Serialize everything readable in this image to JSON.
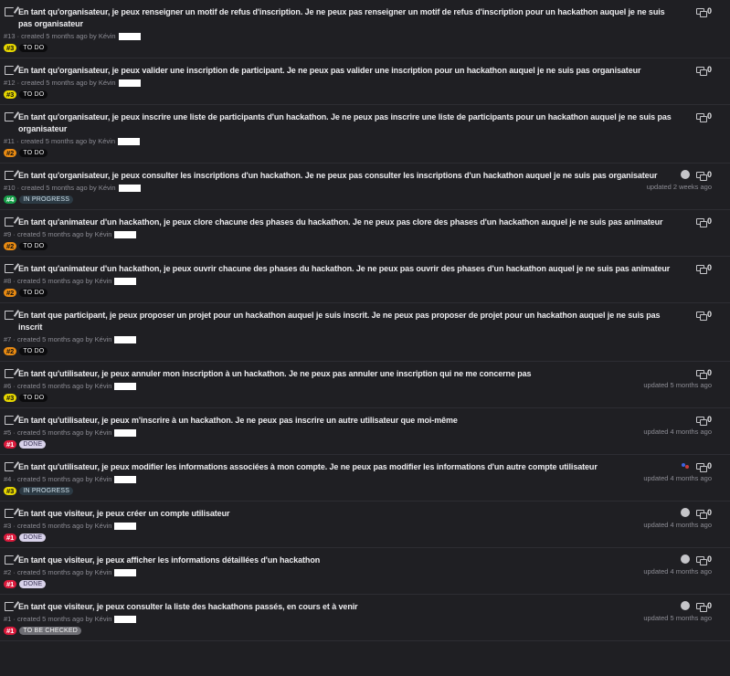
{
  "issues": [
    {
      "title": "En tant qu'organisateur, je peux renseigner un motif de refus d'inscription. Je ne peux pas renseigner un motif de refus d'inscription pour un hackathon auquel je ne suis pas organisateur",
      "meta": "#13 · created 5 months ago by Kévin",
      "badge": "#3",
      "badge_color": "#e6d600",
      "status": "TO DO",
      "status_class": "todo",
      "comments": "0",
      "updated": "",
      "avatar": ""
    },
    {
      "title": "En tant qu'organisateur, je peux valider une inscription de participant. Je ne peux pas valider une inscription pour un hackathon auquel je ne suis pas organisateur",
      "meta": "#12 · created 5 months ago by Kévin",
      "badge": "#3",
      "badge_color": "#e6d600",
      "status": "TO DO",
      "status_class": "todo",
      "comments": "0",
      "updated": "",
      "avatar": ""
    },
    {
      "title": "En tant qu'organisateur, je peux inscrire une liste de participants d'un hackathon. Je ne peux pas inscrire une liste de participants pour un hackathon auquel je ne suis pas organisateur",
      "meta": "#11 · created 5 months ago by Kévin",
      "badge": "#2",
      "badge_color": "#e88a12",
      "status": "TO DO",
      "status_class": "todo",
      "comments": "0",
      "updated": "",
      "avatar": ""
    },
    {
      "title": "En tant qu'organisateur, je peux consulter les inscriptions d'un hackathon. Je ne peux pas consulter les inscriptions d'un hackathon auquel je ne suis pas organisateur",
      "meta": "#10 · created 5 months ago by Kévin",
      "badge": "#4",
      "badge_color": "#18a04a",
      "status": "IN PROGRESS",
      "status_class": "progress",
      "comments": "0",
      "updated": "updated 2 weeks ago",
      "avatar": "grey"
    },
    {
      "title": "En tant qu'animateur d'un hackathon, je peux clore chacune des phases du hackathon. Je ne peux pas clore des phases d'un hackathon auquel je ne suis pas animateur",
      "meta": "#9 · created 5 months ago by Kévin",
      "badge": "#2",
      "badge_color": "#e88a12",
      "status": "TO DO",
      "status_class": "todo",
      "comments": "0",
      "updated": "",
      "avatar": ""
    },
    {
      "title": "En tant qu'animateur d'un hackathon, je peux ouvrir chacune des phases du hackathon. Je ne peux pas ouvrir des phases d'un hackathon auquel je ne suis pas animateur",
      "meta": "#8 · created 5 months ago by Kévin",
      "badge": "#2",
      "badge_color": "#e88a12",
      "status": "TO DO",
      "status_class": "todo",
      "comments": "0",
      "updated": "",
      "avatar": ""
    },
    {
      "title": "En tant que participant, je peux proposer un projet pour un hackathon auquel je suis inscrit. Je ne peux pas proposer de projet pour un hackathon auquel je ne suis pas inscrit",
      "meta": "#7 · created 5 months ago by Kévin",
      "badge": "#2",
      "badge_color": "#e88a12",
      "status": "TO DO",
      "status_class": "todo",
      "comments": "0",
      "updated": "",
      "avatar": ""
    },
    {
      "title": "En tant qu'utilisateur, je peux annuler mon inscription à un hackathon. Je ne peux pas annuler une inscription qui ne me concerne pas",
      "meta": "#6 · created 5 months ago by Kévin",
      "badge": "#3",
      "badge_color": "#e6d600",
      "status": "TO DO",
      "status_class": "todo",
      "comments": "0",
      "updated": "updated 5 months ago",
      "avatar": ""
    },
    {
      "title": "En tant qu'utilisateur, je peux m'inscrire à un hackathon. Je ne peux pas inscrire un autre utilisateur que moi-même",
      "meta": "#5 · created 5 months ago by Kévin",
      "badge": "#1",
      "badge_color": "#dc1a3c",
      "status": "DONE",
      "status_class": "done",
      "comments": "0",
      "updated": "updated 4 months ago",
      "avatar": ""
    },
    {
      "title": "En tant qu'utilisateur, je peux modifier les informations associées à mon compte. Je ne peux pas modifier les informations d'un autre compte utilisateur",
      "meta": "#4 · created 5 months ago by Kévin",
      "badge": "#3",
      "badge_color": "#e6d600",
      "status": "IN PROGRESS",
      "status_class": "progress",
      "comments": "0",
      "updated": "updated 4 months ago",
      "avatar": "multi"
    },
    {
      "title": "En tant que visiteur, je peux créer un compte utilisateur",
      "meta": "#3 · created 5 months ago by Kévin",
      "badge": "#1",
      "badge_color": "#dc1a3c",
      "status": "DONE",
      "status_class": "done",
      "comments": "0",
      "updated": "updated 4 months ago",
      "avatar": "grey"
    },
    {
      "title": "En tant que visiteur, je peux afficher les informations détaillées d'un hackathon",
      "meta": "#2 · created 5 months ago by Kévin",
      "badge": "#1",
      "badge_color": "#dc1a3c",
      "status": "DONE",
      "status_class": "done",
      "comments": "0",
      "updated": "updated 4 months ago",
      "avatar": "grey"
    },
    {
      "title": "En tant que visiteur, je peux consulter la liste des hackathons passés, en cours et à venir",
      "meta": "#1 · created 5 months ago by Kévin",
      "badge": "#1",
      "badge_color": "#dc1a3c",
      "status": "TO BE CHECKED",
      "status_class": "check",
      "comments": "0",
      "updated": "updated 5 months ago",
      "avatar": "grey"
    }
  ]
}
